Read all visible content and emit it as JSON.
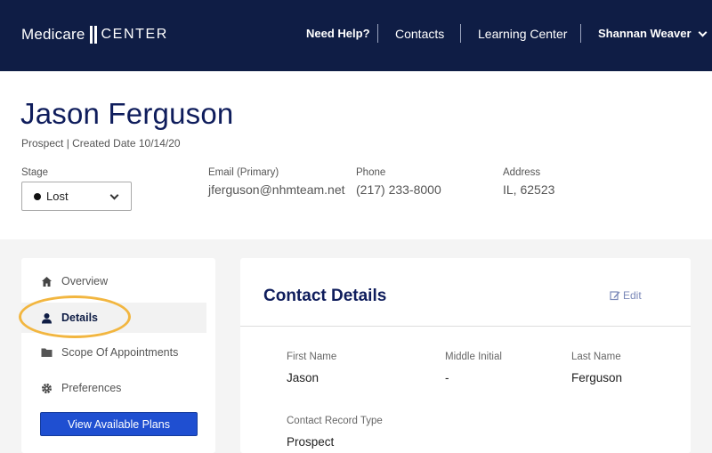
{
  "brand": {
    "part1": "Medicare",
    "part2": "CENTER"
  },
  "nav": {
    "help": "Need Help?",
    "contacts": "Contacts",
    "learning": "Learning Center",
    "user": "Shannan Weaver"
  },
  "contact": {
    "name": "Jason Ferguson",
    "meta": "Prospect | Created Date  10/14/20",
    "stage_label": "Stage",
    "stage_value": "Lost",
    "email_label": "Email (Primary)",
    "email": "jferguson@nhmteam.net",
    "phone_label": "Phone",
    "phone": "(217) 233-8000",
    "address_label": "Address",
    "address": "IL, 62523"
  },
  "sidebar": {
    "items": [
      {
        "label": "Overview",
        "icon": "home-icon"
      },
      {
        "label": "Details",
        "icon": "user-icon"
      },
      {
        "label": "Scope Of Appointments",
        "icon": "folder-icon"
      },
      {
        "label": "Preferences",
        "icon": "gear-icon"
      }
    ],
    "active": "Details",
    "button": "View Available Plans"
  },
  "details": {
    "title": "Contact Details",
    "edit": "Edit",
    "fields": {
      "first_name_label": "First Name",
      "first_name": "Jason",
      "middle_label": "Middle Initial",
      "middle": "-",
      "last_name_label": "Last Name",
      "last_name": "Ferguson",
      "record_type_label": "Contact Record Type",
      "record_type": "Prospect"
    }
  },
  "colors": {
    "navy": "#0f1d45",
    "accent_blue": "#1f4fd1",
    "highlight": "#f2b640"
  }
}
